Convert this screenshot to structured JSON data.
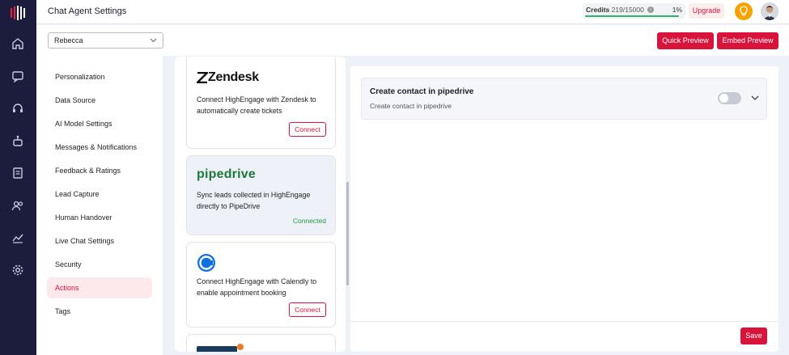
{
  "header": {
    "title": "Chat Agent Settings",
    "credits_label": "Credits",
    "credits_value": "219/15000",
    "credits_percent": "1%",
    "credits_progress": 0.01,
    "upgrade_label": "Upgrade"
  },
  "rail": {
    "items": [
      "home-icon",
      "chat-icon",
      "headset-icon",
      "bot-icon",
      "notes-icon",
      "users-icon",
      "analytics-icon",
      "settings-icon"
    ]
  },
  "agent_select": {
    "value": "Rebecca"
  },
  "toolbar": {
    "quick_preview": "Quick Preview",
    "embed_preview": "Embed Preview"
  },
  "sidebar": {
    "items": [
      {
        "label": "Personalization"
      },
      {
        "label": "Data Source"
      },
      {
        "label": "AI Model Settings"
      },
      {
        "label": "Messages & Notifications"
      },
      {
        "label": "Feedback & Ratings"
      },
      {
        "label": "Lead Capture"
      },
      {
        "label": "Human Handover"
      },
      {
        "label": "Live Chat Settings"
      },
      {
        "label": "Security"
      },
      {
        "label": "Actions",
        "active": true
      },
      {
        "label": "Tags"
      }
    ]
  },
  "integrations": [
    {
      "brand": "zendesk",
      "logo_text": "Zendesk",
      "desc": "Connect HighEngage with Zendesk to automatically create tickets",
      "action": "Connect"
    },
    {
      "brand": "pipedrive",
      "logo_text": "pipedrive",
      "desc": "Sync leads collected in HighEngage directly to PipeDrive",
      "status": "Connected"
    },
    {
      "brand": "calendly",
      "desc": "Connect HighEngage with Calendly to enable appointment booking",
      "action": "Connect"
    }
  ],
  "detail": {
    "action_title": "Create contact in pipedrive",
    "action_subtitle": "Create contact in pipedrive",
    "toggle_on": false,
    "save_label": "Save"
  },
  "colors": {
    "accent": "#d8133c",
    "rail": "#1c1c3c",
    "connected": "#1e9a4a",
    "pipedrive_brand": "#1a7a3c"
  }
}
